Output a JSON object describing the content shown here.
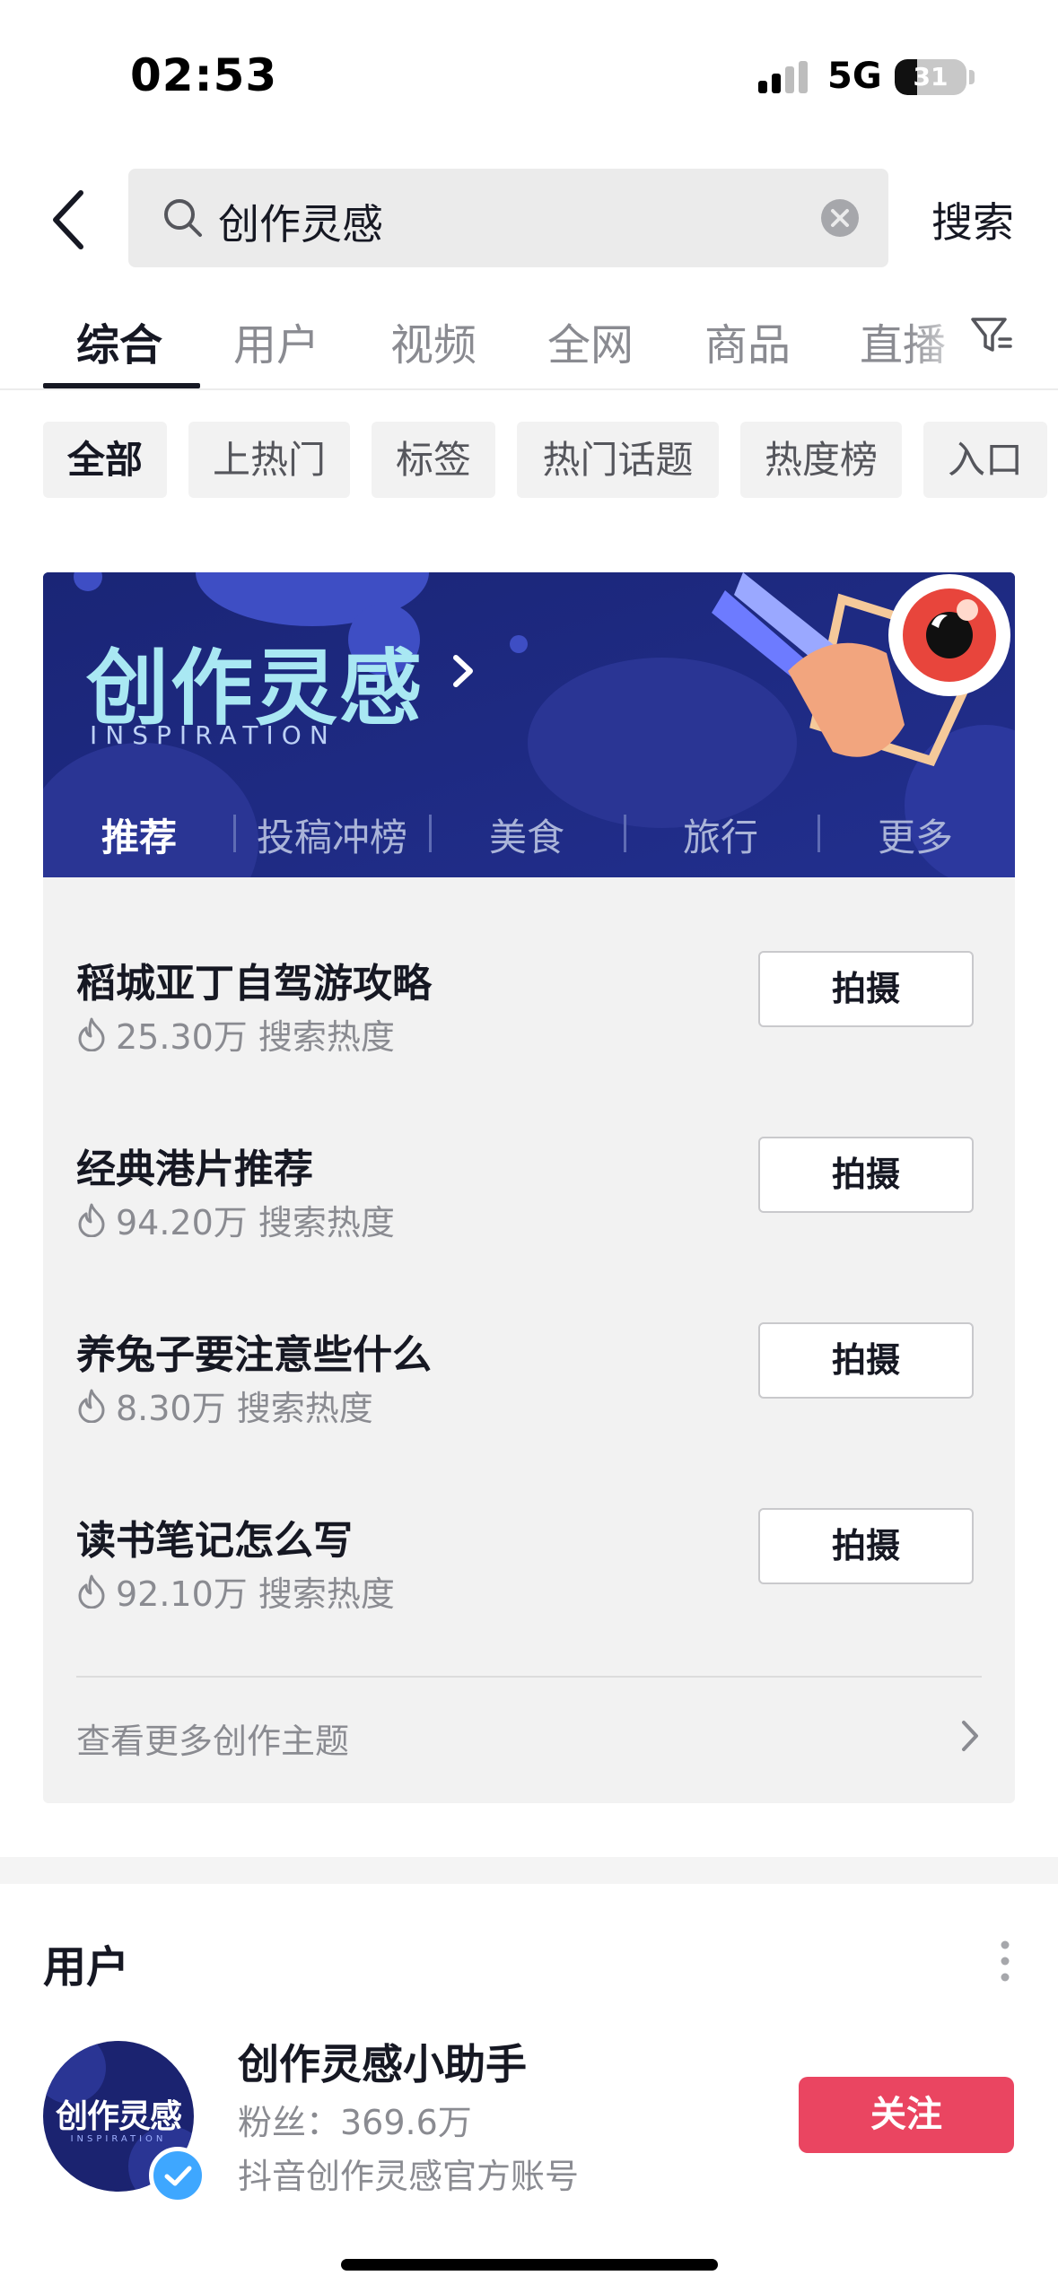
{
  "status_bar": {
    "time": "02:53",
    "network": "5G",
    "battery": "31",
    "battery_level_percent": 31
  },
  "search": {
    "query": "创作灵感",
    "submit_label": "搜索"
  },
  "tabs": [
    {
      "label": "综合",
      "active": true
    },
    {
      "label": "用户"
    },
    {
      "label": "视频"
    },
    {
      "label": "全网"
    },
    {
      "label": "商品"
    },
    {
      "label": "直播"
    }
  ],
  "chips": [
    {
      "label": "全部",
      "active": true
    },
    {
      "label": "上热门"
    },
    {
      "label": "标签"
    },
    {
      "label": "热门话题"
    },
    {
      "label": "热度榜"
    },
    {
      "label": "入口"
    }
  ],
  "inspiration": {
    "title": "创作灵感",
    "subtitle": "INSPIRATION",
    "categories": [
      {
        "label": "推荐",
        "active": true
      },
      {
        "label": "投稿冲榜"
      },
      {
        "label": "美食"
      },
      {
        "label": "旅行"
      },
      {
        "label": "更多"
      }
    ],
    "topics": [
      {
        "title": "稻城亚丁自驾游攻略",
        "heat": "25.30万 搜索热度",
        "button": "拍摄"
      },
      {
        "title": "经典港片推荐",
        "heat": "94.20万 搜索热度",
        "button": "拍摄"
      },
      {
        "title": "养兔子要注意些什么",
        "heat": "8.30万 搜索热度",
        "button": "拍摄"
      },
      {
        "title": "读书笔记怎么写",
        "heat": "92.10万 搜索热度",
        "button": "拍摄"
      }
    ],
    "more_label": "查看更多创作主题"
  },
  "users": {
    "section_title": "用户",
    "user": {
      "avatar_text": "创作灵感",
      "avatar_sub": "INSPIRATION",
      "name": "创作灵感小助手",
      "fans": "粉丝：369.6万",
      "desc": "抖音创作灵感官方账号",
      "follow_label": "关注"
    }
  },
  "colors": {
    "accent_red": "#ea4561",
    "banner_bg": "#1e2a7a",
    "banner_title": "#a9e8f3",
    "verified_blue": "#3ea7ff"
  },
  "icons": [
    "back-arrow-icon",
    "search-icon",
    "clear-icon",
    "filter-icon",
    "chevron-right-icon",
    "fire-icon",
    "more-vertical-icon",
    "verified-check-icon"
  ]
}
